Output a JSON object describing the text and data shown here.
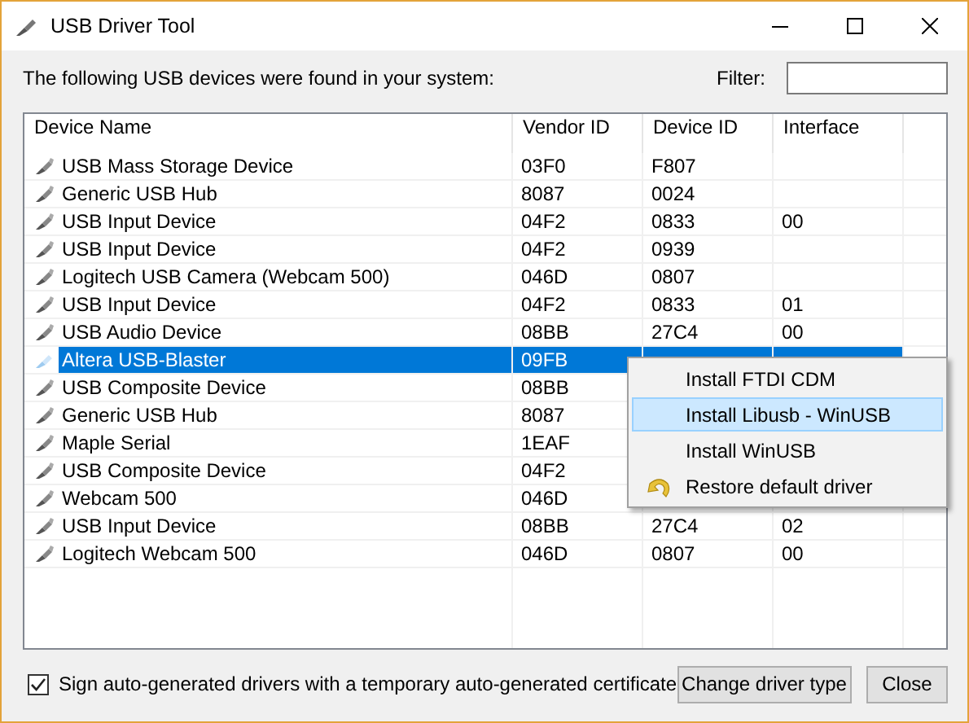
{
  "window": {
    "title": "USB Driver Tool"
  },
  "intro": "The following USB devices were found in your system:",
  "filter": {
    "label": "Filter:"
  },
  "table": {
    "columns": [
      "Device Name",
      "Vendor ID",
      "Device ID",
      "Interface"
    ],
    "rows": [
      {
        "name": "USB Mass Storage Device",
        "vendor": "03F0",
        "device": "F807",
        "selected": false
      },
      {
        "name": "Generic USB Hub",
        "vendor": "8087",
        "device": "0024",
        "selected": false
      },
      {
        "name": "USB Input Device",
        "vendor": "04F2",
        "device": "0833",
        "interface": "00",
        "selected": false
      },
      {
        "name": "USB Input Device",
        "vendor": "04F2",
        "device": "0939",
        "selected": false
      },
      {
        "name": "Logitech USB Camera (Webcam 500)",
        "vendor": "046D",
        "device": "0807",
        "selected": false
      },
      {
        "name": "USB Input Device",
        "vendor": "04F2",
        "device": "0833",
        "interface": "01",
        "selected": false
      },
      {
        "name": "USB Audio Device",
        "vendor": "08BB",
        "device": "27C4",
        "interface": "00",
        "selected": false
      },
      {
        "name": "Altera USB-Blaster",
        "vendor": "09FB",
        "selected": true
      },
      {
        "name": "USB Composite Device",
        "vendor": "08BB",
        "selected": false
      },
      {
        "name": "Generic USB Hub",
        "vendor": "8087",
        "selected": false
      },
      {
        "name": "Maple Serial",
        "vendor": "1EAF",
        "selected": false
      },
      {
        "name": "USB Composite Device",
        "vendor": "04F2",
        "selected": false
      },
      {
        "name": "Webcam 500",
        "vendor": "046D",
        "selected": false
      },
      {
        "name": "USB Input Device",
        "vendor": "08BB",
        "device": "27C4",
        "interface": "02",
        "selected": false
      },
      {
        "name": "Logitech Webcam 500",
        "vendor": "046D",
        "device": "0807",
        "interface": "00",
        "selected": false
      }
    ]
  },
  "context_menu": [
    {
      "label": "Install FTDI CDM",
      "selected": false
    },
    {
      "label": "Install Libusb - WinUSB",
      "selected": true
    },
    {
      "label": "Install WinUSB",
      "selected": false
    },
    {
      "label": "Restore default driver",
      "selected": false,
      "kind": "restore"
    }
  ],
  "sign_checkbox": {
    "label": "Sign auto-generated drivers with a temporary auto-generated certificate",
    "checked": true
  },
  "buttons": [
    "Change driver type",
    "Close"
  ]
}
